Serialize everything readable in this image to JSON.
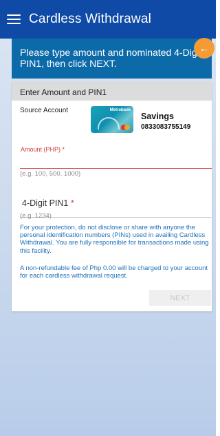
{
  "appbar": {
    "title": "Cardless Withdrawal"
  },
  "banner": {
    "text": "Please type amount and nominated 4-Digit PIN1, then click NEXT."
  },
  "card": {
    "header": "Enter Amount and PIN1",
    "source_label": "Source Account",
    "account_card": {
      "brand": "Metrobank"
    },
    "account_type": "Savings",
    "account_number": "0833083755149"
  },
  "amount": {
    "label": "Amount (PHP) *",
    "value": "",
    "hint": "(e.g. 100, 500, 1000)"
  },
  "pin": {
    "label": "4-Digit PIN1",
    "required_mark": "*",
    "value": "",
    "hint": "(e.g. 1234)"
  },
  "info": {
    "protection": "For your protection, do not disclose or share with anyone the personal identification numbers (PINs) used in availing Cardless Withdrawal. You are fully responsible for transactions made using this facility.",
    "fee": "A non-refundable fee of Php 0.00 will be charged to your account for each cardless withdrawal request."
  },
  "actions": {
    "next_label": "NEXT"
  },
  "colors": {
    "appbar": "#0f4ba6",
    "banner": "#0d6aa9",
    "back_button": "#f39b34",
    "required": "#d43a3a",
    "info_text": "#1e6fb8"
  },
  "icons": {
    "menu": "hamburger-menu-icon",
    "back": "arrow-left-icon"
  }
}
